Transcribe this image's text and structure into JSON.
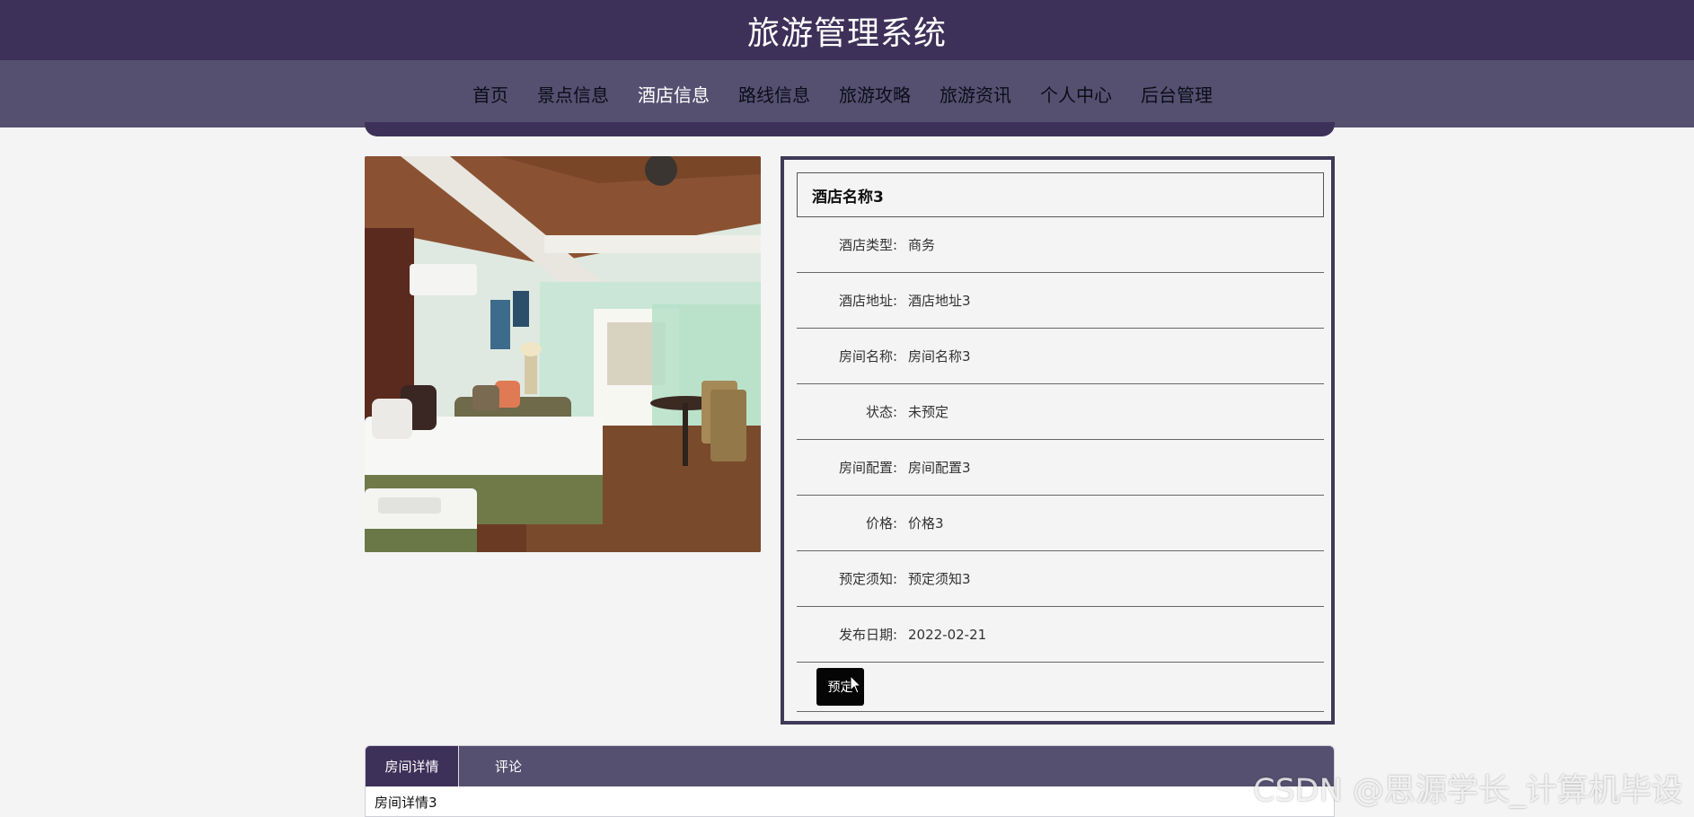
{
  "header": {
    "title": "旅游管理系统"
  },
  "nav": {
    "items": [
      {
        "label": "首页",
        "active": false
      },
      {
        "label": "景点信息",
        "active": false
      },
      {
        "label": "酒店信息",
        "active": true
      },
      {
        "label": "路线信息",
        "active": false
      },
      {
        "label": "旅游攻略",
        "active": false
      },
      {
        "label": "旅游资讯",
        "active": false
      },
      {
        "label": "个人中心",
        "active": false
      },
      {
        "label": "后台管理",
        "active": false
      }
    ]
  },
  "hotel": {
    "name": "酒店名称3",
    "fields": [
      {
        "label": "酒店类型:",
        "value": "商务"
      },
      {
        "label": "酒店地址:",
        "value": "酒店地址3"
      },
      {
        "label": "房间名称:",
        "value": "房间名称3"
      },
      {
        "label": "状态:",
        "value": "未预定"
      },
      {
        "label": "房间配置:",
        "value": "房间配置3"
      },
      {
        "label": "价格:",
        "value": "价格3"
      },
      {
        "label": "预定须知:",
        "value": "预定须知3"
      },
      {
        "label": "发布日期:",
        "value": "2022-02-21"
      }
    ],
    "book_label": "预定"
  },
  "tabs": {
    "items": [
      {
        "label": "房间详情",
        "active": true
      },
      {
        "label": "评论",
        "active": false
      }
    ],
    "content": "房间详情3"
  },
  "watermark": "CSDN @思源学长_计算机毕设",
  "colors": {
    "header_bg": "#3e3159",
    "nav_bg": "#555070",
    "button_bg": "#050505"
  }
}
